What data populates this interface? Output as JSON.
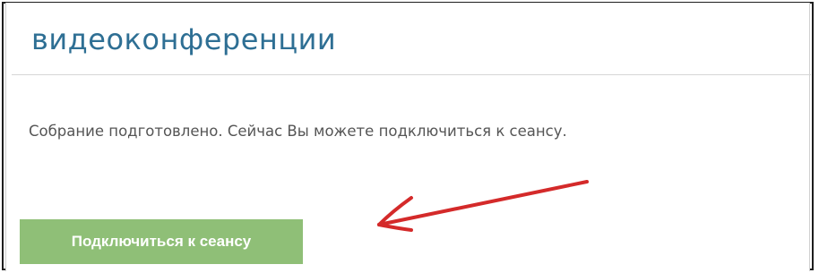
{
  "page": {
    "heading": "видеоконференции",
    "message": "Собрание подготовлено. Сейчас Вы можете подключиться к сеансу.",
    "connect_button_label": "Подключиться к сеансу"
  },
  "annotation": {
    "arrow_color": "#d42a2a",
    "icon": "red-arrow-icon"
  },
  "colors": {
    "heading": "#2e6f94",
    "message_text": "#555555",
    "button_bg": "#8fbf77",
    "button_text": "#ffffff",
    "frame_border": "#1e1e1e"
  }
}
